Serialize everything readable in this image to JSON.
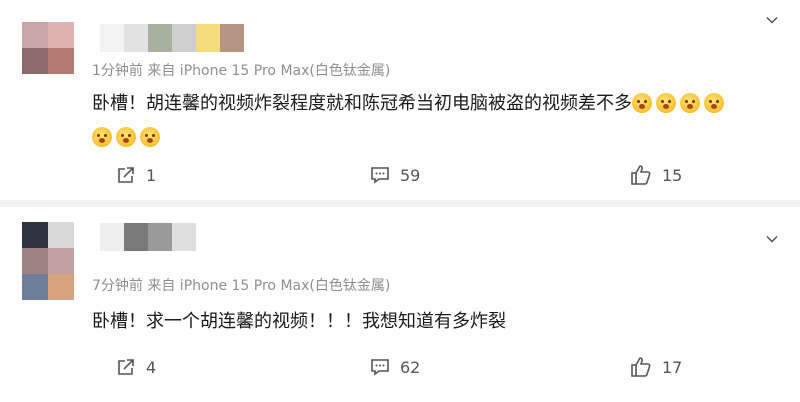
{
  "comments": [
    {
      "meta": "1分钟前 来自 iPhone 15 Pro Max(白色钛金属)",
      "text_main": "卧槽！胡连馨的视频炸裂程度就和陈冠希当初电脑被盗的视频差不多",
      "emoji_inline_count": 4,
      "emoji_line2_count": 3,
      "emoji_icon": "astonished-face-icon",
      "reposts": "1",
      "replies": "59",
      "likes": "15"
    },
    {
      "meta": "7分钟前 来自 iPhone 15 Pro Max(白色钛金属)",
      "text_main": "卧槽！求一个胡连馨的视频！！！我想知道有多炸裂",
      "reposts": "4",
      "replies": "62",
      "likes": "17"
    }
  ],
  "icons": {
    "more": "chevron-down-icon",
    "share": "share-icon",
    "reply": "comment-icon",
    "like": "thumbs-up-icon"
  },
  "colors": {
    "separator": "#f2f2f2",
    "meta_text": "#8f8f8f",
    "action_text": "#555555"
  }
}
